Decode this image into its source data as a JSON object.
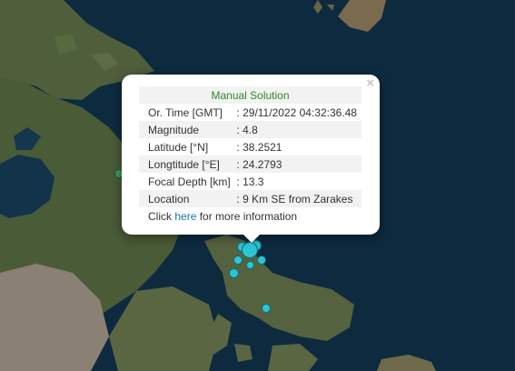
{
  "map": {
    "water_color": "#0e2a3f",
    "land_color": "#4b5e3a",
    "marker_color": "#2ec4d6"
  },
  "popup": {
    "close_glyph": "×",
    "heading": "Manual Solution",
    "rows": [
      {
        "label": "Or. Time [GMT]",
        "value": ": 29/11/2022 04:32:36.48"
      },
      {
        "label": "Magnitude",
        "value": ": 4.8"
      },
      {
        "label": "Latitude [°N]",
        "value": ": 38.2521"
      },
      {
        "label": "Longtitude [°E]",
        "value": ": 24.2793"
      },
      {
        "label": "Focal Depth [km]",
        "value": ": 13.3"
      },
      {
        "label": "Location",
        "value": ": 9 Km SE from Zarakes"
      }
    ],
    "footer_prefix": "Click ",
    "footer_link": "here",
    "footer_suffix": " for more information",
    "heading_color": "#2e8b26",
    "link_color": "#1a73a8"
  }
}
